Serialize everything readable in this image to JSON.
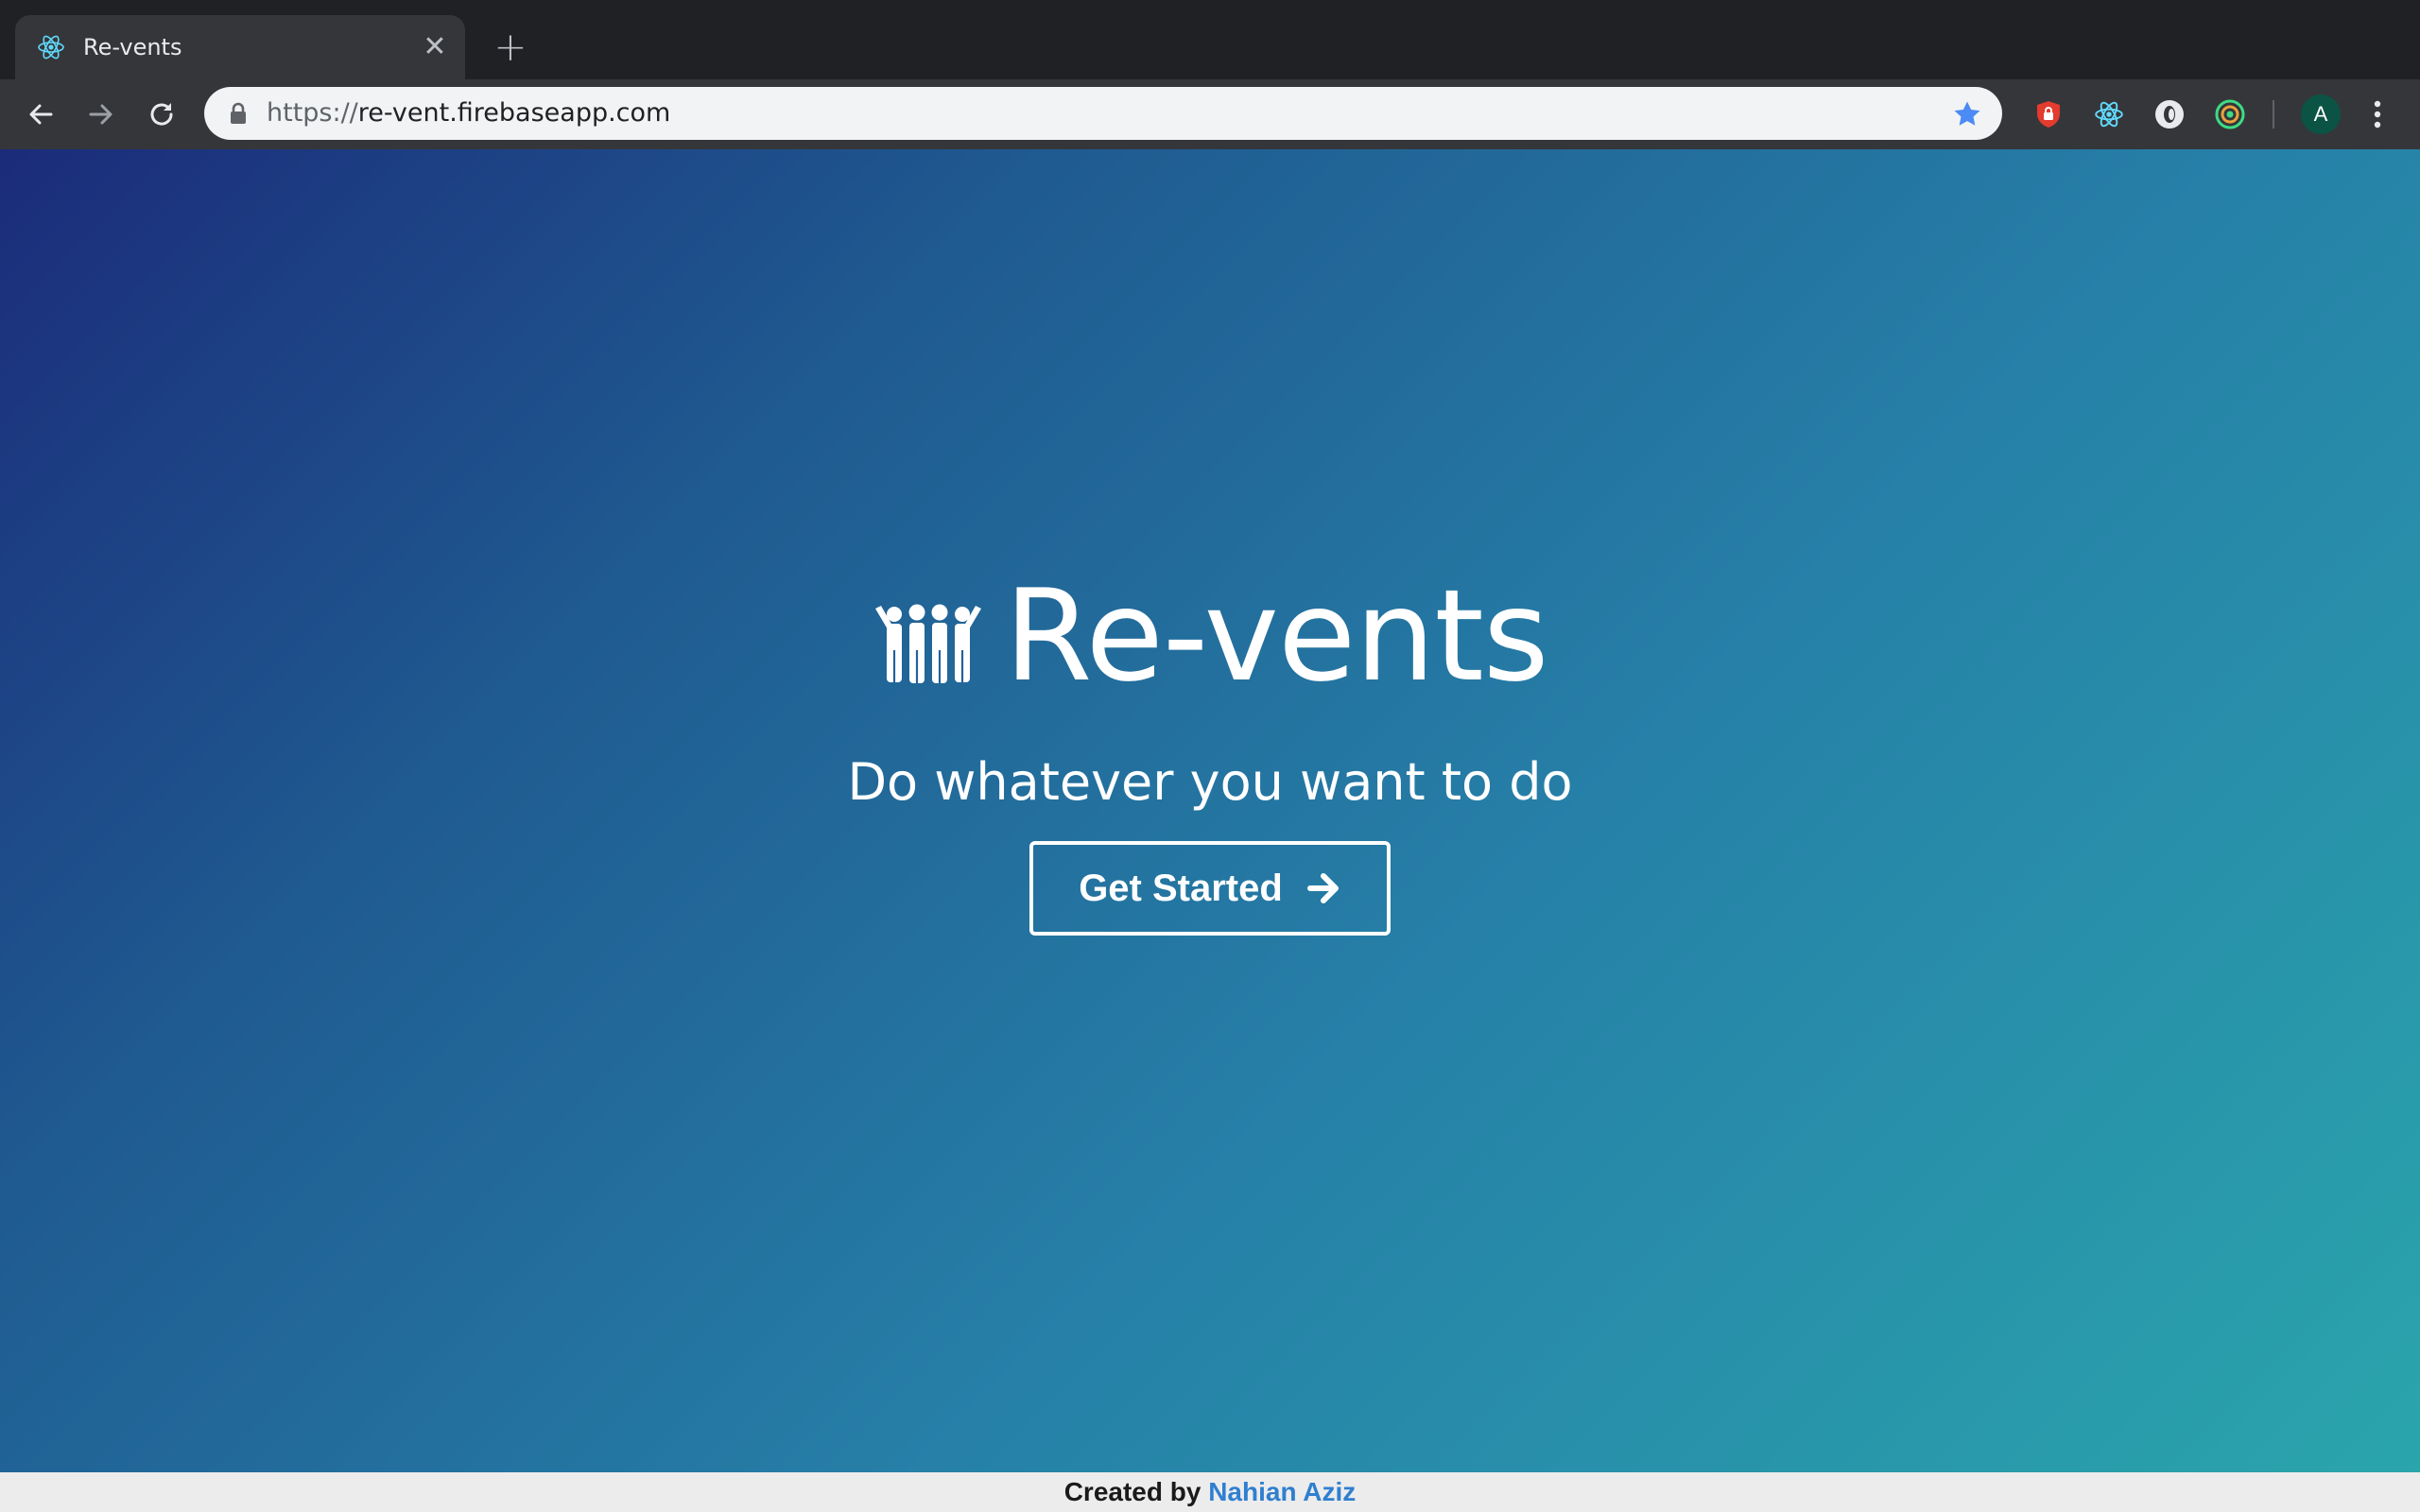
{
  "browser": {
    "tab": {
      "title": "Re-vents",
      "favicon": "react-atom-icon",
      "close_glyph": "✕"
    },
    "new_tab_glyph": "+",
    "address": {
      "scheme": "https://",
      "host": "re-vent.firebaseapp.com"
    },
    "extensions": [
      "shield-extension-icon",
      "react-devtools-icon",
      "circle-extension-icon",
      "target-extension-icon"
    ],
    "profile_initial": "A"
  },
  "hero": {
    "title": "Re-vents",
    "tagline": "Do whatever you want to do",
    "cta_label": "Get Started"
  },
  "footer": {
    "prefix": "Created by",
    "author": "Nahian Aziz"
  },
  "colors": {
    "gradient_start": "#1b2b7a",
    "gradient_end": "#2aa5ac",
    "link": "#2f7fd0",
    "star": "#4c8bf5"
  }
}
